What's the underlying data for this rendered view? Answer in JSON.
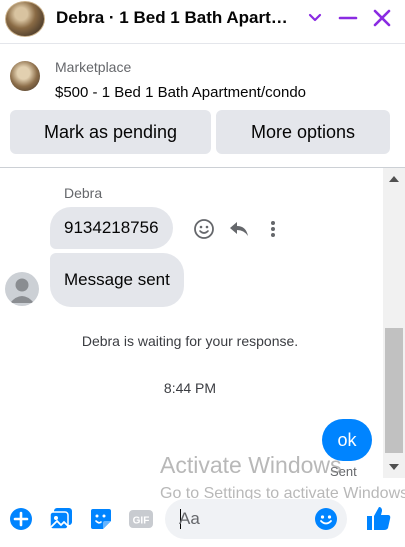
{
  "header": {
    "title": "Debra · 1 Bed 1 Bath Apart…",
    "accent_color": "#8a2be2",
    "icons": [
      "chat-avatar",
      "chevron-down-icon",
      "minimize-icon",
      "close-icon"
    ]
  },
  "listing": {
    "source": "Marketplace",
    "title": "$500 - 1 Bed 1 Bath Apartment/condo",
    "primary_button": "Mark as pending",
    "secondary_button": "More options"
  },
  "thread": {
    "sender_name": "Debra",
    "messages_in": [
      "9134218756",
      "Message sent"
    ],
    "message_actions": [
      "react-icon",
      "reply-icon",
      "more-icon"
    ],
    "system_notice": "Debra is waiting for your response.",
    "timestamp": "8:44 PM",
    "message_out": "ok",
    "delivery_status": "Sent"
  },
  "watermark": {
    "line1": "Activate Windows",
    "line2": "Go to Settings to activate Windows."
  },
  "composer": {
    "placeholder": "Aa",
    "icons": [
      "plus-icon",
      "photo-icon",
      "sticker-icon",
      "gif-icon",
      "emoji-icon",
      "like-icon"
    ],
    "accent_color": "#0084ff"
  }
}
